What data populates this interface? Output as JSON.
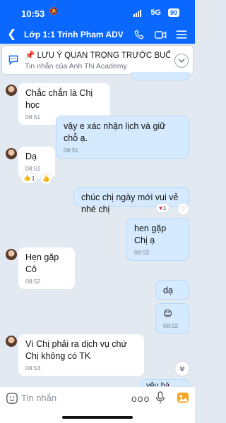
{
  "status": {
    "time": "10:53",
    "network": "5G",
    "battery": "90"
  },
  "nav": {
    "title": "Lớp 1:1 Trinh Pham ADV..."
  },
  "pinned": {
    "text": "LƯU Ý QUAN TRỌNG TRƯỚC BUỔ...",
    "source": "Tin nhắn của Anh Thi Academy"
  },
  "messages": [
    {
      "text": "Chắc chắn là Chị học",
      "time": "08:51"
    },
    {
      "text": "vậy e xác nhận lịch và giữ chỗ ạ.",
      "time": "08:51"
    },
    {
      "text": "Dạ",
      "time": "08:51",
      "reaction_count": "1"
    },
    {
      "text": "chúc chị ngày mới vui vẻ nhé chị",
      "reaction_count": "1"
    },
    {
      "text": "hen gặp Chị ạ",
      "time": "08:52"
    },
    {
      "text": "Hẹn gặp Cô",
      "time": "08:52"
    },
    {
      "text": "dạ"
    },
    {
      "text": "😊",
      "time": "08:52"
    },
    {
      "text": "Vì Chị phải ra dịch vụ chứ Chị không có TK",
      "time": "08:53"
    },
    {
      "text": "yêu bà Chị"
    }
  ],
  "composer": {
    "placeholder": "Tin nhắn"
  },
  "colors": {
    "brand": "#0a68ff",
    "outgoing_bubble": "#d5eaff",
    "background": "#e2e9f1"
  }
}
